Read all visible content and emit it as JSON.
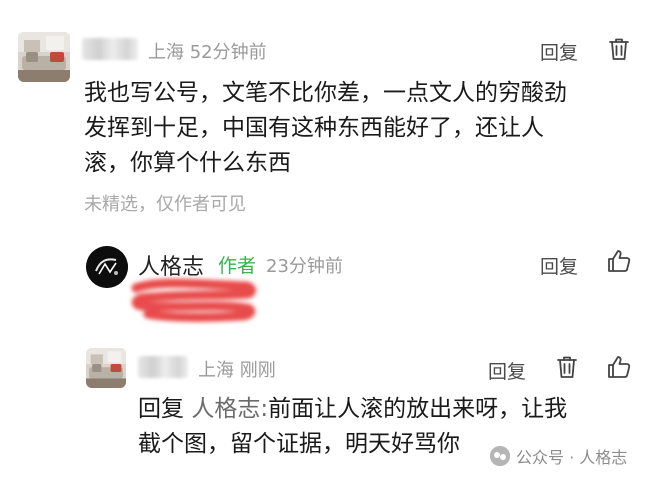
{
  "comments": [
    {
      "location": "上海",
      "time": "52分钟前",
      "reply_label": "回复",
      "body_lines": [
        "我也写公号，文笔不比你差，一点文人的穷酸劲",
        "发挥到十足，中国有这种东西能好了，还让人",
        "滚，你算个什么东西"
      ],
      "status_note": "未精选，仅作者可见"
    },
    {
      "author_name": "人格志",
      "author_badge": "作者",
      "time": "23分钟前",
      "reply_label": "回复"
    },
    {
      "location": "上海",
      "time": "刚刚",
      "reply_label": "回复",
      "reply_prefix": "回复",
      "reply_target": "人格志:",
      "body_lines": [
        "前面让人滚的放出来呀，让我",
        "截个图，留个证据，明天好骂你"
      ]
    }
  ],
  "watermark": {
    "text": "公众号 · 人格志"
  },
  "icons": {
    "delete": "trash-icon",
    "like": "thumbs-up-icon"
  },
  "colors": {
    "author_badge": "#37b34a",
    "redaction": "#e84b4b"
  }
}
